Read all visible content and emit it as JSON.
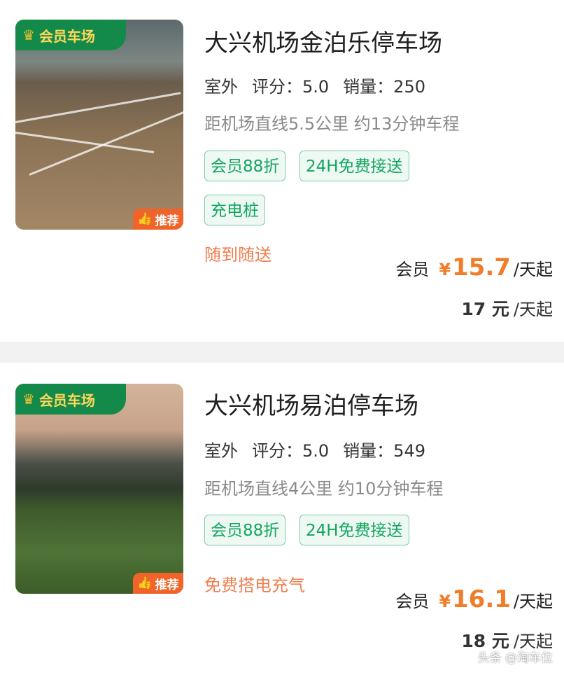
{
  "colors": {
    "brand_green": "#138a4a",
    "tag_green": "#13a55f",
    "price_orange": "#f07d2a",
    "promo_orange": "#f07d4d"
  },
  "listings": [
    {
      "badge": "会员车场",
      "recommend": "推荐",
      "title": "大兴机场金泊乐停车场",
      "type": "室外",
      "rating": "评分：5.0",
      "sales": "销量：250",
      "distance": "距机场直线5.5公里 约13分钟车程",
      "tags": [
        "会员88折",
        "24H免费接送",
        "充电桩"
      ],
      "promo": "随到随送",
      "member_label": "会员",
      "currency": "¥",
      "member_price": "15.7",
      "price_unit": "/天起",
      "normal_price": "17 元",
      "normal_unit": "/天起",
      "icons": [
        "crown-icon",
        "thumbs-up-icon"
      ]
    },
    {
      "badge": "会员车场",
      "recommend": "推荐",
      "title": "大兴机场易泊停车场",
      "type": "室外",
      "rating": "评分：5.0",
      "sales": "销量：549",
      "distance": "距机场直线4公里 约10分钟车程",
      "tags": [
        "会员88折",
        "24H免费接送"
      ],
      "promo": "免费搭电充气",
      "member_label": "会员",
      "currency": "¥",
      "member_price": "16.1",
      "price_unit": "/天起",
      "normal_price": "18 元",
      "normal_unit": "/天起",
      "icons": [
        "crown-icon",
        "thumbs-up-icon"
      ]
    }
  ],
  "watermark": "头条 @淘车位"
}
